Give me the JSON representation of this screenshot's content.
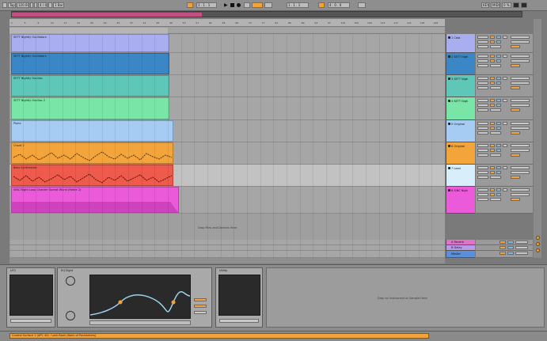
{
  "control_bar": {
    "tap_label": "Tap",
    "tempo": "120.00",
    "time_sig": "4 / 4",
    "metronome_label": "1 Bar",
    "position": "1 . 1 . 1",
    "loop_start": "1 . 1 . 1",
    "loop_len": "4 . 0 . 0",
    "key_label": "KEY",
    "midi_label": "MIDI",
    "cpu": "0 %"
  },
  "tracks": [
    {
      "clip": "SETT Nightly Oscillators",
      "header": "1 Ceta",
      "color": "#a8aef0"
    },
    {
      "clip": "SETT Nightly Oscillators",
      "header": "2 SETT Nigh",
      "color": "#3b87c6"
    },
    {
      "clip": "SETT Nightly Oscilloc",
      "header": "3 SETT Nigh",
      "color": "#5fc7b7"
    },
    {
      "clip": "SETT Nightly Oscilloc 2",
      "header": "4 SETT Nigh",
      "color": "#79e6a8"
    },
    {
      "clip": "Piano",
      "header": "5 Original",
      "color": "#a6ccf4"
    },
    {
      "clip": "Chord 2",
      "header": "6 Original",
      "color": "#f3a53c"
    },
    {
      "clip": "Bass Synthesizer",
      "header": "7 Lead",
      "color": "#ee5a4c"
    },
    {
      "clip": "SINC Night Loop Chanter Operat Wurst (Retire 2)",
      "header": "8 SINC Nigh",
      "color": "#ea5ad9"
    }
  ],
  "returns": [
    {
      "header": "A Reverb",
      "color": "#e271c8"
    },
    {
      "header": "B Delay",
      "color": "#b89ae6"
    },
    {
      "header": "Master",
      "color": "#5b8fd9"
    }
  ],
  "arrangement_drop_text": "Drop Files and Devices Here",
  "ruler_ticks": [
    "1",
    "5",
    "9",
    "13",
    "17",
    "21",
    "25",
    "29",
    "33",
    "37",
    "41",
    "45",
    "49",
    "53",
    "57",
    "61",
    "65",
    "69",
    "73",
    "77",
    "81",
    "85",
    "89",
    "93",
    "97",
    "101",
    "105",
    "109",
    "113",
    "117",
    "121",
    "125",
    "129"
  ],
  "devices": [
    {
      "title": "LFO"
    },
    {
      "title": "EQ Eight"
    },
    {
      "title": "Utility"
    }
  ],
  "device_drop_text": "Drop an Instrument or Sample Here",
  "status_text": "Control Surface 1 (APC 40) : Lock Bank (Bank of Parameters)"
}
